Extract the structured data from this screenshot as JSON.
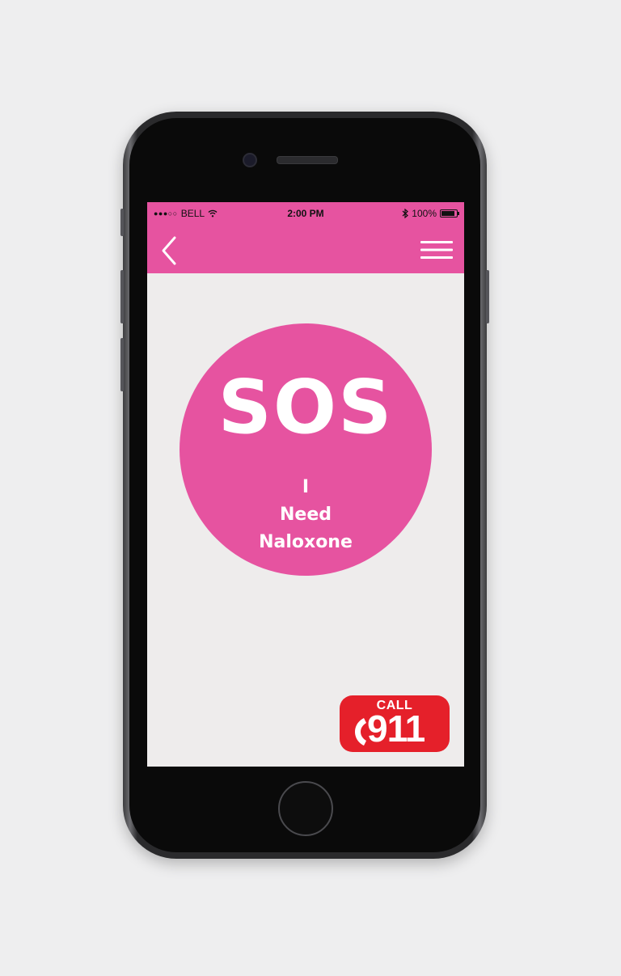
{
  "status_bar": {
    "signal": "●●●○○",
    "carrier": "BELL",
    "time": "2:00 PM",
    "battery_percent": "100%",
    "battery_level": 1.0
  },
  "nav": {
    "back_icon": "chevron-left-icon",
    "menu_icon": "hamburger-menu-icon"
  },
  "sos": {
    "title": "SOS",
    "line1": "I",
    "line2": "Need",
    "line3": "Naloxone"
  },
  "call": {
    "label": "CALL",
    "number": "911",
    "icon": "phone-handset-icon"
  },
  "colors": {
    "accent": "#e653a0",
    "call_red": "#e5202a",
    "screen_bg": "#eeecec"
  }
}
